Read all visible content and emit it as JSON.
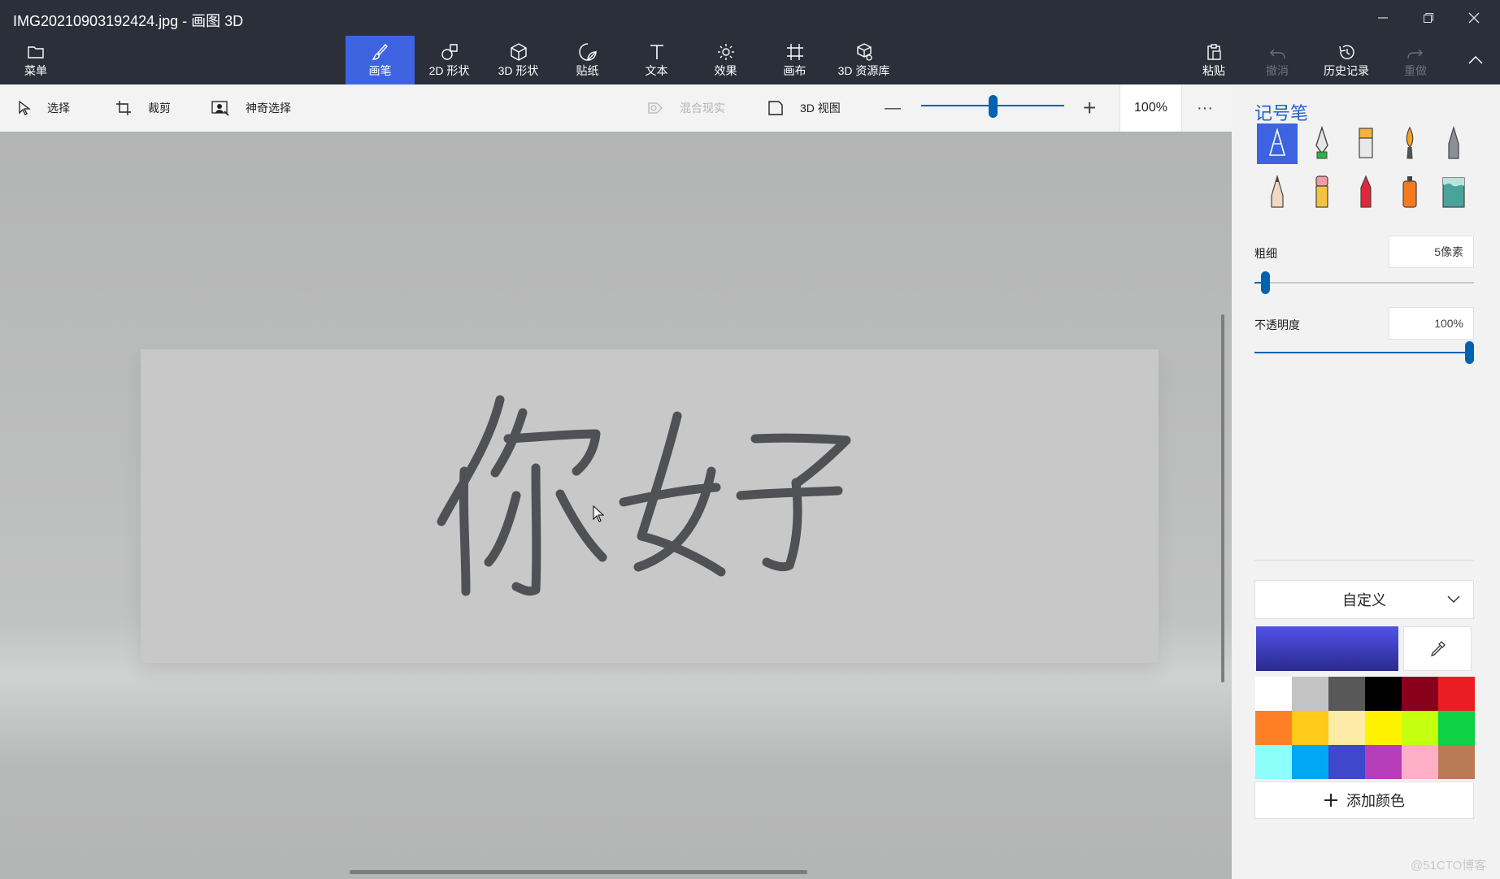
{
  "window": {
    "title": "IMG20210903192424.jpg - 画图 3D",
    "controls": {
      "minimize": "—",
      "restore": "❐",
      "close": "✕"
    }
  },
  "ribbon": {
    "menu_label": "菜单",
    "tools": [
      {
        "label": "画笔",
        "icon": "brush-icon"
      },
      {
        "label": "2D 形状",
        "icon": "shapes-2d-icon"
      },
      {
        "label": "3D 形状",
        "icon": "cube-icon"
      },
      {
        "label": "贴纸",
        "icon": "sticker-icon"
      },
      {
        "label": "文本",
        "icon": "text-icon"
      },
      {
        "label": "效果",
        "icon": "effects-icon"
      },
      {
        "label": "画布",
        "icon": "canvas-icon"
      },
      {
        "label": "3D 资源库",
        "icon": "library-icon"
      }
    ],
    "right": {
      "paste_label": "粘贴",
      "undo_label": "撤消",
      "history_label": "历史记录",
      "redo_label": "重做"
    }
  },
  "toolbar": {
    "select_label": "选择",
    "crop_label": "裁剪",
    "magic_select_label": "神奇选择",
    "mixed_reality_label": "混合现实",
    "view_3d_label": "3D 视图",
    "zoom_out": "—",
    "zoom_in": "+",
    "zoom_level": "100%",
    "more": "···"
  },
  "panel": {
    "title": "记号笔",
    "brushes_selected": "marker",
    "thickness_label": "粗细",
    "thickness_value": "5像素",
    "thickness_fraction": 0.05,
    "opacity_label": "不透明度",
    "opacity_value": "100%",
    "opacity_fraction": 1.0,
    "color_mode": "自定义",
    "current_color": "#3c3cc0",
    "palette": [
      "#ffffff",
      "#c3c3c3",
      "#585858",
      "#000000",
      "#88001b",
      "#ec1c24",
      "#ff7f27",
      "#ffca18",
      "#fdeca6",
      "#fff200",
      "#c4ff0e",
      "#0ed145",
      "#8cfffb",
      "#00a8f3",
      "#3f48cc",
      "#b83dba",
      "#ffaec8",
      "#b97a56"
    ],
    "add_color_label": "添加颜色"
  },
  "canvas": {
    "handwritten_text": "你好"
  },
  "watermark": "@51CTO博客"
}
